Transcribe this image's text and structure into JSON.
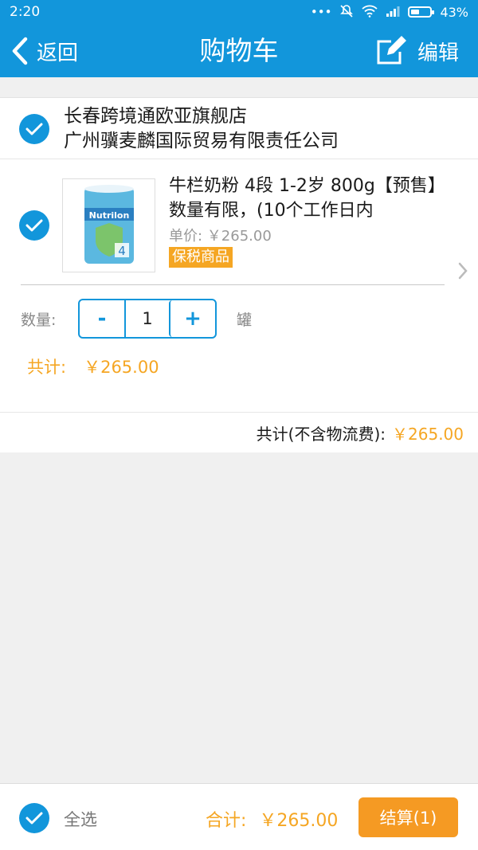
{
  "status_bar": {
    "time": "2:20",
    "battery": "43%"
  },
  "nav": {
    "back_label": "返回",
    "title": "购物车",
    "edit_label": "编辑"
  },
  "shop": {
    "line1": "长春跨境通欧亚旗舰店",
    "line2": "广州骥麦麟国际贸易有限责任公司"
  },
  "item": {
    "title": "牛栏奶粉 4段 1-2岁 800g【预售】数量有限，(10个工作日内",
    "unit_price": "单价: ￥265.00",
    "tag": "保税商品",
    "qty_label": "数量:",
    "minus": "-",
    "quantity": "1",
    "plus": "+",
    "unit": "罐",
    "total_label": "共计:",
    "total_value": "￥265.00",
    "image_brand": "Nutrilon"
  },
  "summary": {
    "label": "共计(不含物流费):",
    "value": "￥265.00"
  },
  "footer": {
    "select_all": "全选",
    "total_label": "合计:",
    "total_value": "￥265.00",
    "checkout": "结算(1)"
  },
  "colors": {
    "primary": "#1296db",
    "accent": "#f5a623",
    "background": "#f0f0f0"
  }
}
